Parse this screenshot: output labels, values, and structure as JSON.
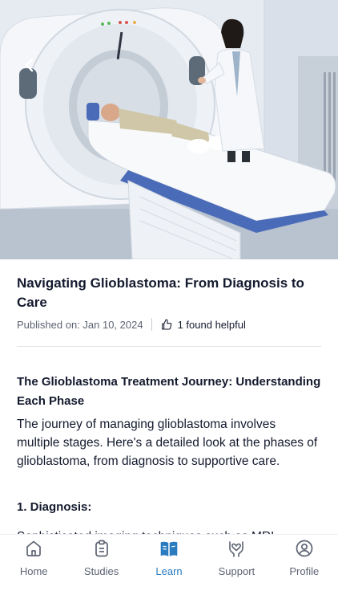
{
  "article": {
    "title": "Navigating Glioblastoma: From Diagnosis to Care",
    "published": "Published on: Jan 10, 2024",
    "helpful": "1 found helpful",
    "section_title": "The Glioblastoma Treatment Journey: Understanding Each Phase",
    "body": "The journey of managing glioblastoma involves multiple stages. Here's a detailed look at the phases of glioblastoma, from diagnosis to supportive care.",
    "subsection_title": "1. Diagnosis:",
    "peek_text": "Sophisticated imaging techniques such as MRI"
  },
  "nav": {
    "items": [
      {
        "label": "Home",
        "icon": "home-icon"
      },
      {
        "label": "Studies",
        "icon": "clipboard-icon"
      },
      {
        "label": "Learn",
        "icon": "book-icon"
      },
      {
        "label": "Support",
        "icon": "support-hands-icon"
      },
      {
        "label": "Profile",
        "icon": "profile-icon"
      }
    ],
    "active": "Learn"
  },
  "colors": {
    "accent": "#2a7bbf",
    "text": "#141a2e",
    "muted": "#5d6373"
  }
}
